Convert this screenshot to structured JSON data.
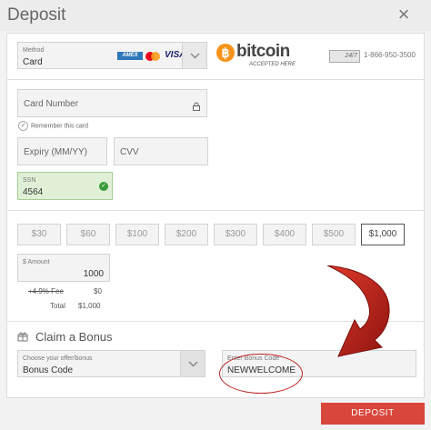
{
  "window": {
    "title": "Deposit",
    "close_glyph": "×"
  },
  "method": {
    "label": "Method",
    "value": "Card",
    "amex": "AMEX",
    "visa": "VISA"
  },
  "bitcoin": {
    "glyph": "฿",
    "name": "bitcoin",
    "accepted": "ACCEPTED HERE"
  },
  "support": {
    "badge": "24/7",
    "phone": "1-866-950-3500"
  },
  "card": {
    "number_placeholder": "Card Number",
    "remember_label": "Remember this card",
    "expiry_placeholder": "Expiry (MM/YY)",
    "cvv_placeholder": "CVV",
    "ssn_label": "SSN",
    "ssn_value": "4564"
  },
  "amounts": [
    "$30",
    "$60",
    "$100",
    "$200",
    "$300",
    "$400",
    "$500",
    "$1,000"
  ],
  "selected_amount_index": 7,
  "amount": {
    "label": "$ Amount",
    "value": "1000"
  },
  "fee": {
    "label": "+4.9% Fee",
    "value": "$0"
  },
  "total": {
    "label": "Total",
    "value": "$1,000"
  },
  "bonus": {
    "title": "Claim a Bonus",
    "offer_label": "Choose your offer/bonus",
    "offer_value": "Bonus Code",
    "code_label": "Enter Bonus Code",
    "code_value": "NEWWELCOME"
  },
  "deposit_button": "DEPOSIT",
  "colors": {
    "accent": "#d9463b",
    "ssn_valid_bg": "#dff0d6",
    "annotation": "#b22222"
  }
}
